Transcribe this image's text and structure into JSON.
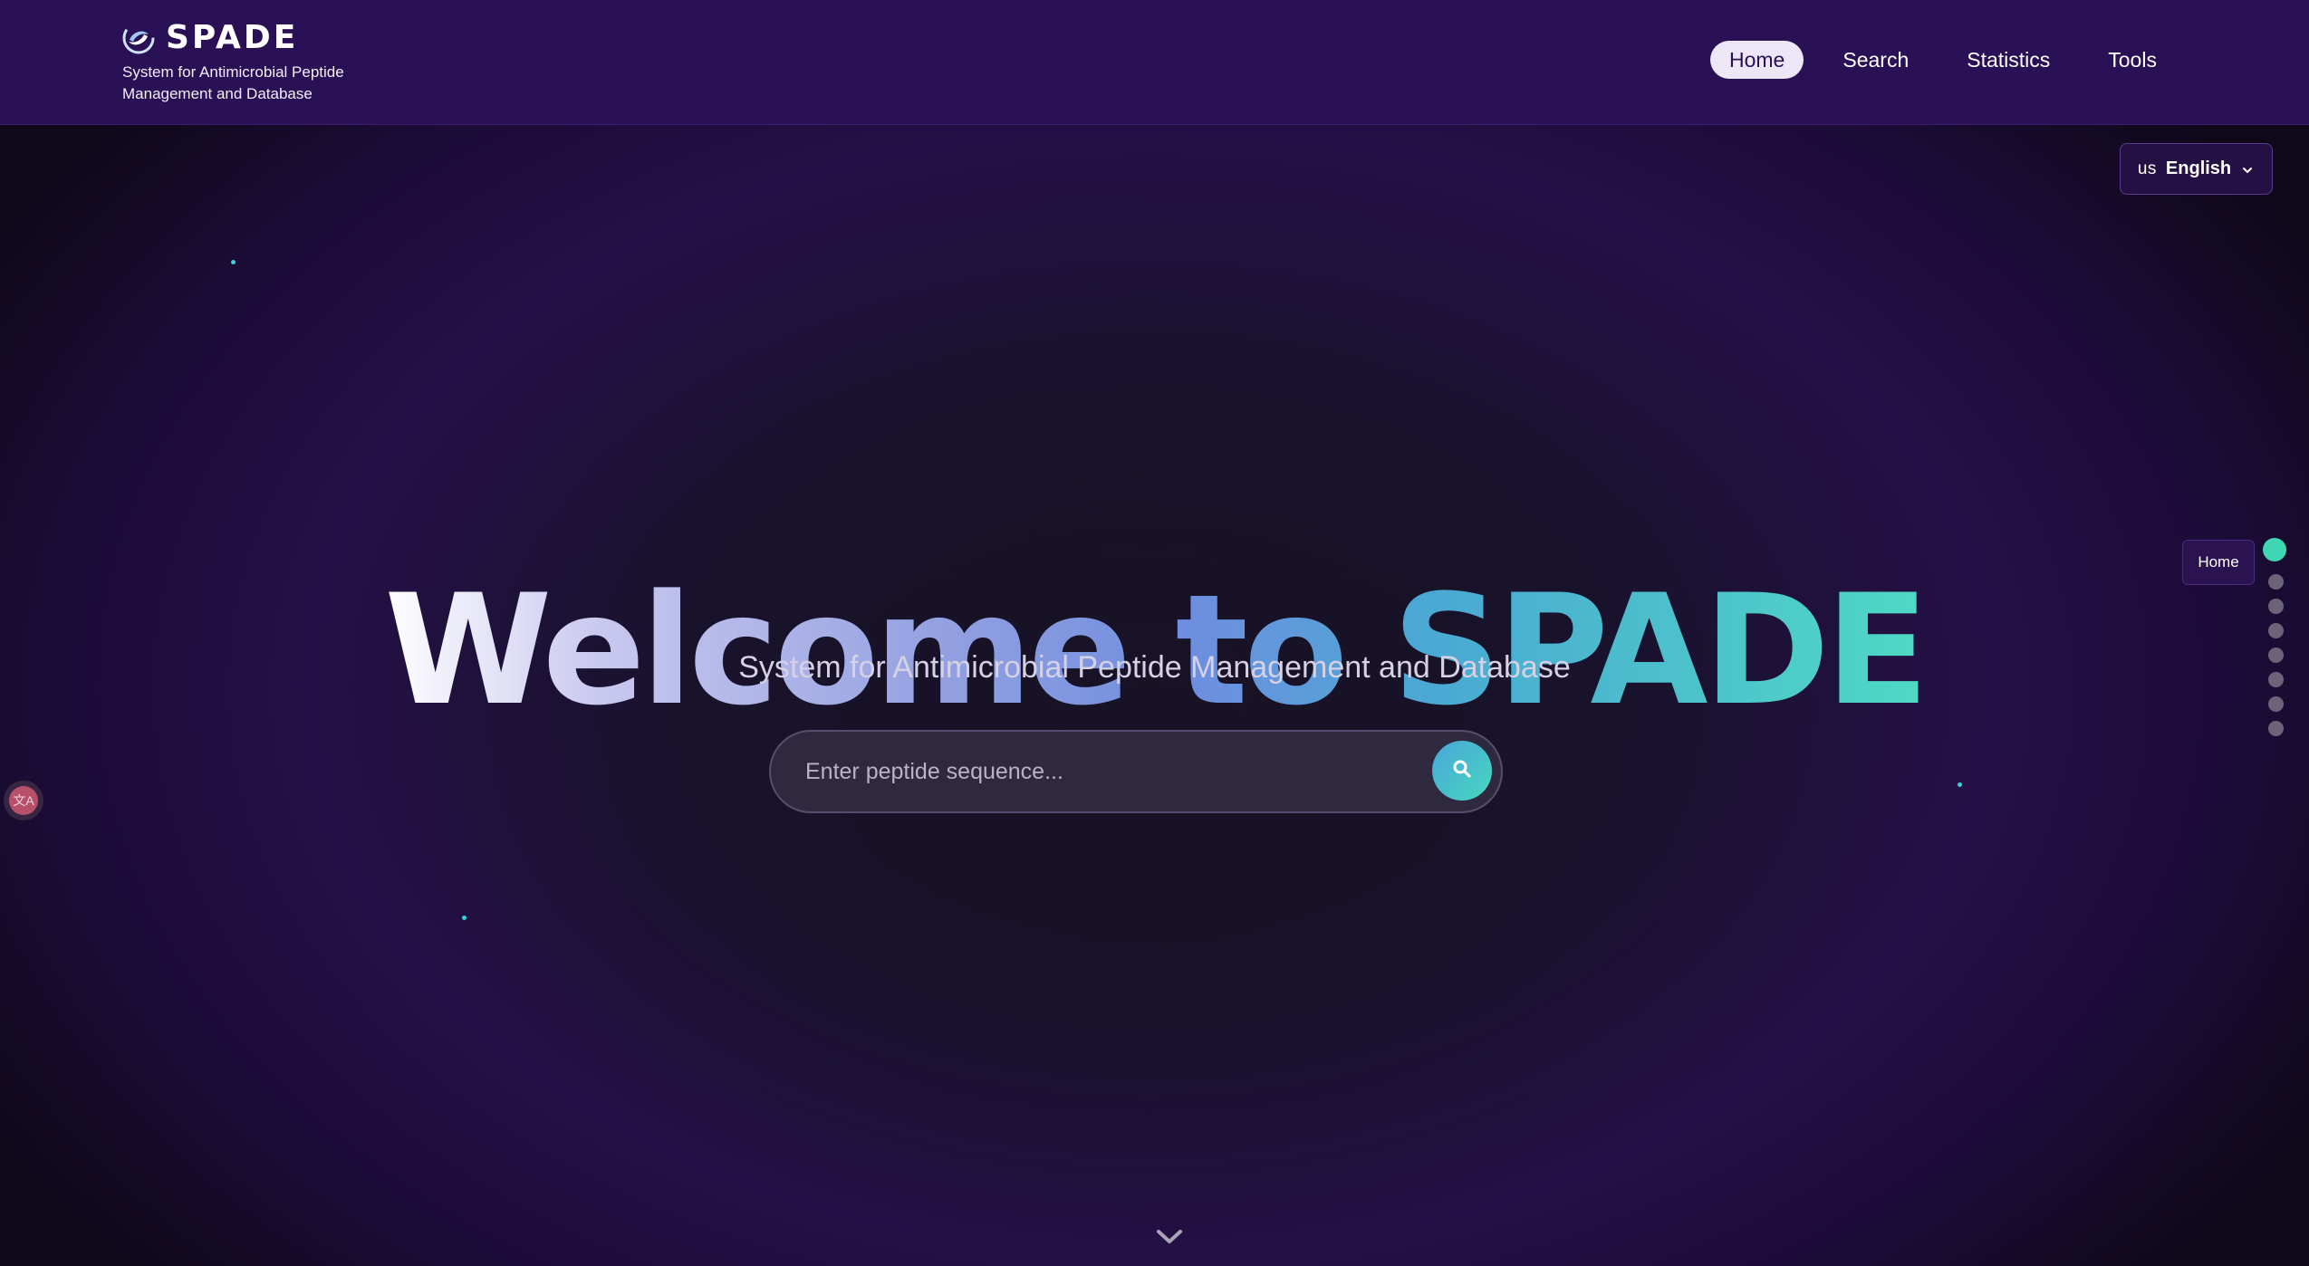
{
  "header": {
    "brand_name": "SPADE",
    "tagline": "System for Antimicrobial Peptide Management and Database",
    "nav": [
      {
        "label": "Home",
        "active": true
      },
      {
        "label": "Search"
      },
      {
        "label": "Statistics"
      },
      {
        "label": "Tools"
      }
    ]
  },
  "language": {
    "flag": "us",
    "label": "English"
  },
  "hero": {
    "title": "Welcome to SPADE",
    "subtitle": "System for Antimicrobial Peptide Management and Database"
  },
  "search": {
    "placeholder": "Enter peptide sequence...",
    "icon": "search-icon"
  },
  "section_nav": {
    "current_label": "Home",
    "count": 8,
    "active_index": 0
  },
  "colors": {
    "header_bg": "#2a1054",
    "accent_teal": "#3ed6b3",
    "gradient_start": "#ffffff",
    "gradient_end": "#4fd9c4"
  }
}
